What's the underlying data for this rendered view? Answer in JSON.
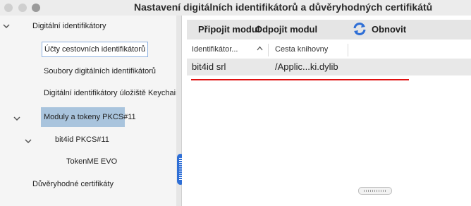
{
  "window": {
    "title": "Nastavení digitálních identifikátorů a důvěryhodných certifikátů"
  },
  "tree": {
    "items": [
      {
        "label": "Digitální identifikátory"
      },
      {
        "label": "Účty cestovních identifikátorů"
      },
      {
        "label": "Soubory digitálních identifikátorů"
      },
      {
        "label": "Digitální identifikátory úložiště Keychain"
      },
      {
        "label": "Moduly a tokeny PKCS#11"
      },
      {
        "label": "bit4id PKCS#11"
      },
      {
        "label": "TokenME EVO"
      },
      {
        "label": "Důvěryhodné certifikáty"
      }
    ]
  },
  "toolbar": {
    "connect_label": "Připojit modul",
    "disconnect_label": "Odpojit modul",
    "refresh_label": "Obnovit"
  },
  "table": {
    "columns": [
      "Identifikátor...",
      "Cesta knihovny"
    ],
    "rows": [
      [
        "bit4id srl",
        "/Applic...ki.dylib"
      ]
    ]
  },
  "colors": {
    "selection": "#a9c4dd",
    "accent": "#2f6fd6",
    "annotation_underline": "#e01010"
  }
}
